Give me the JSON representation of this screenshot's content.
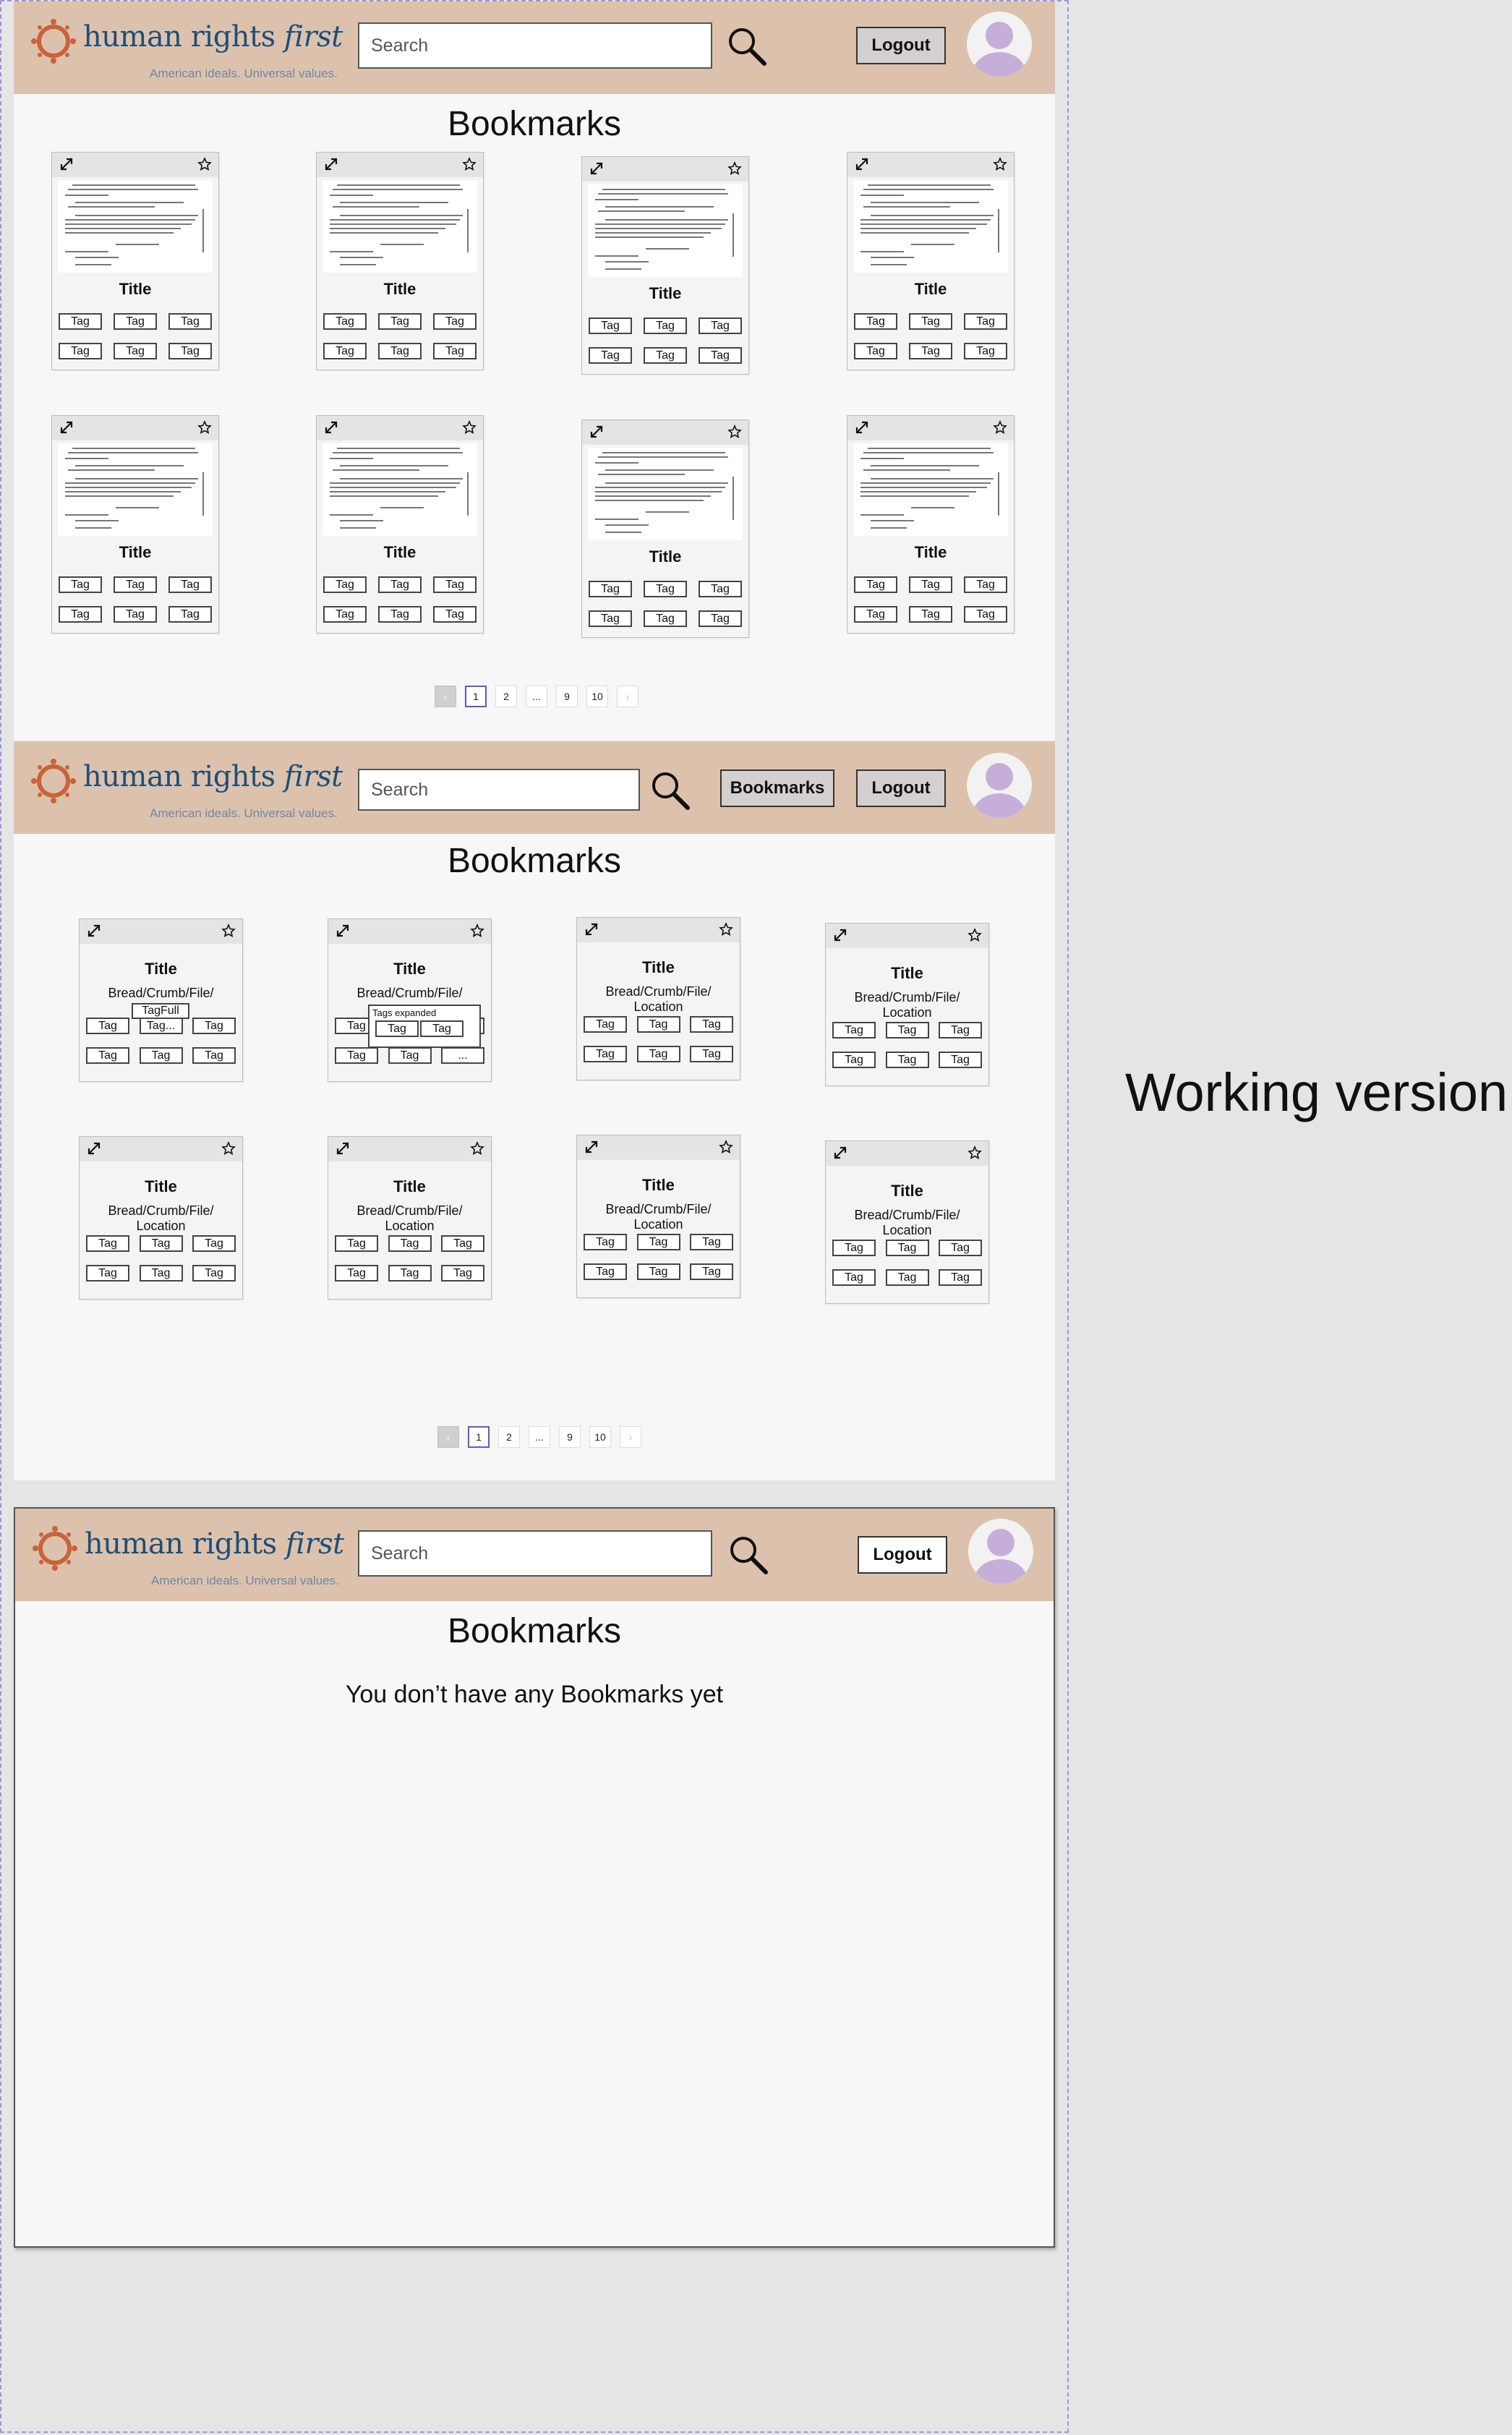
{
  "brand": {
    "name": "human rights",
    "name_accent": "first",
    "tagline": "American ideals. Universal values."
  },
  "search": {
    "placeholder": "Search"
  },
  "buttons": {
    "logout": "Logout",
    "bookmarks": "Bookmarks"
  },
  "page_title": "Bookmarks",
  "card": {
    "title": "Title",
    "breadcrumb_line1": "Bread/Crumb/File/",
    "breadcrumb_line2": "Location",
    "tag": "Tag"
  },
  "annotations": {
    "tag_full": "TagFull",
    "tag_truncated": "Tag...",
    "tags_expanded": "Tags expanded",
    "more": "...",
    "working_version": "Working version!"
  },
  "pagination": {
    "pages": [
      "1",
      "2",
      "...",
      "9",
      "10"
    ],
    "current": "1"
  },
  "empty_state": "You don’t have any Bookmarks yet"
}
